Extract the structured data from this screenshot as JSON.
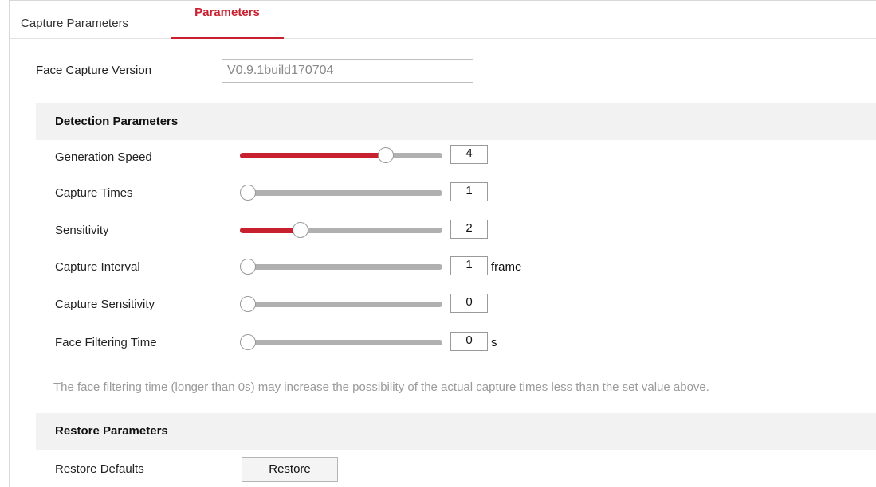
{
  "tabs": [
    {
      "label": "Capture Parameters",
      "active": false
    },
    {
      "label": "Parameters",
      "active": true
    }
  ],
  "version": {
    "label": "Face Capture Version",
    "value": "V0.9.1build170704"
  },
  "detection": {
    "title": "Detection Parameters",
    "rows": [
      {
        "label": "Generation Speed",
        "value": "4",
        "level": 0.74,
        "unit": ""
      },
      {
        "label": "Capture Times",
        "value": "1",
        "level": 0.0,
        "unit": ""
      },
      {
        "label": "Sensitivity",
        "value": "2",
        "level": 0.28,
        "unit": ""
      },
      {
        "label": "Capture Interval",
        "value": "1",
        "level": 0.0,
        "unit": "frame"
      },
      {
        "label": "Capture Sensitivity",
        "value": "0",
        "level": 0.0,
        "unit": ""
      },
      {
        "label": "Face Filtering Time",
        "value": "0",
        "level": 0.0,
        "unit": "s"
      }
    ],
    "hint": "The face filtering time (longer than 0s) may increase the possibility of the actual capture times less than the set value above."
  },
  "restore": {
    "title": "Restore Parameters",
    "label": "Restore Defaults",
    "button": "Restore"
  },
  "colors": {
    "accent": "#c8202f",
    "track": "#b0b0b0",
    "section_bg": "#f2f2f2"
  }
}
